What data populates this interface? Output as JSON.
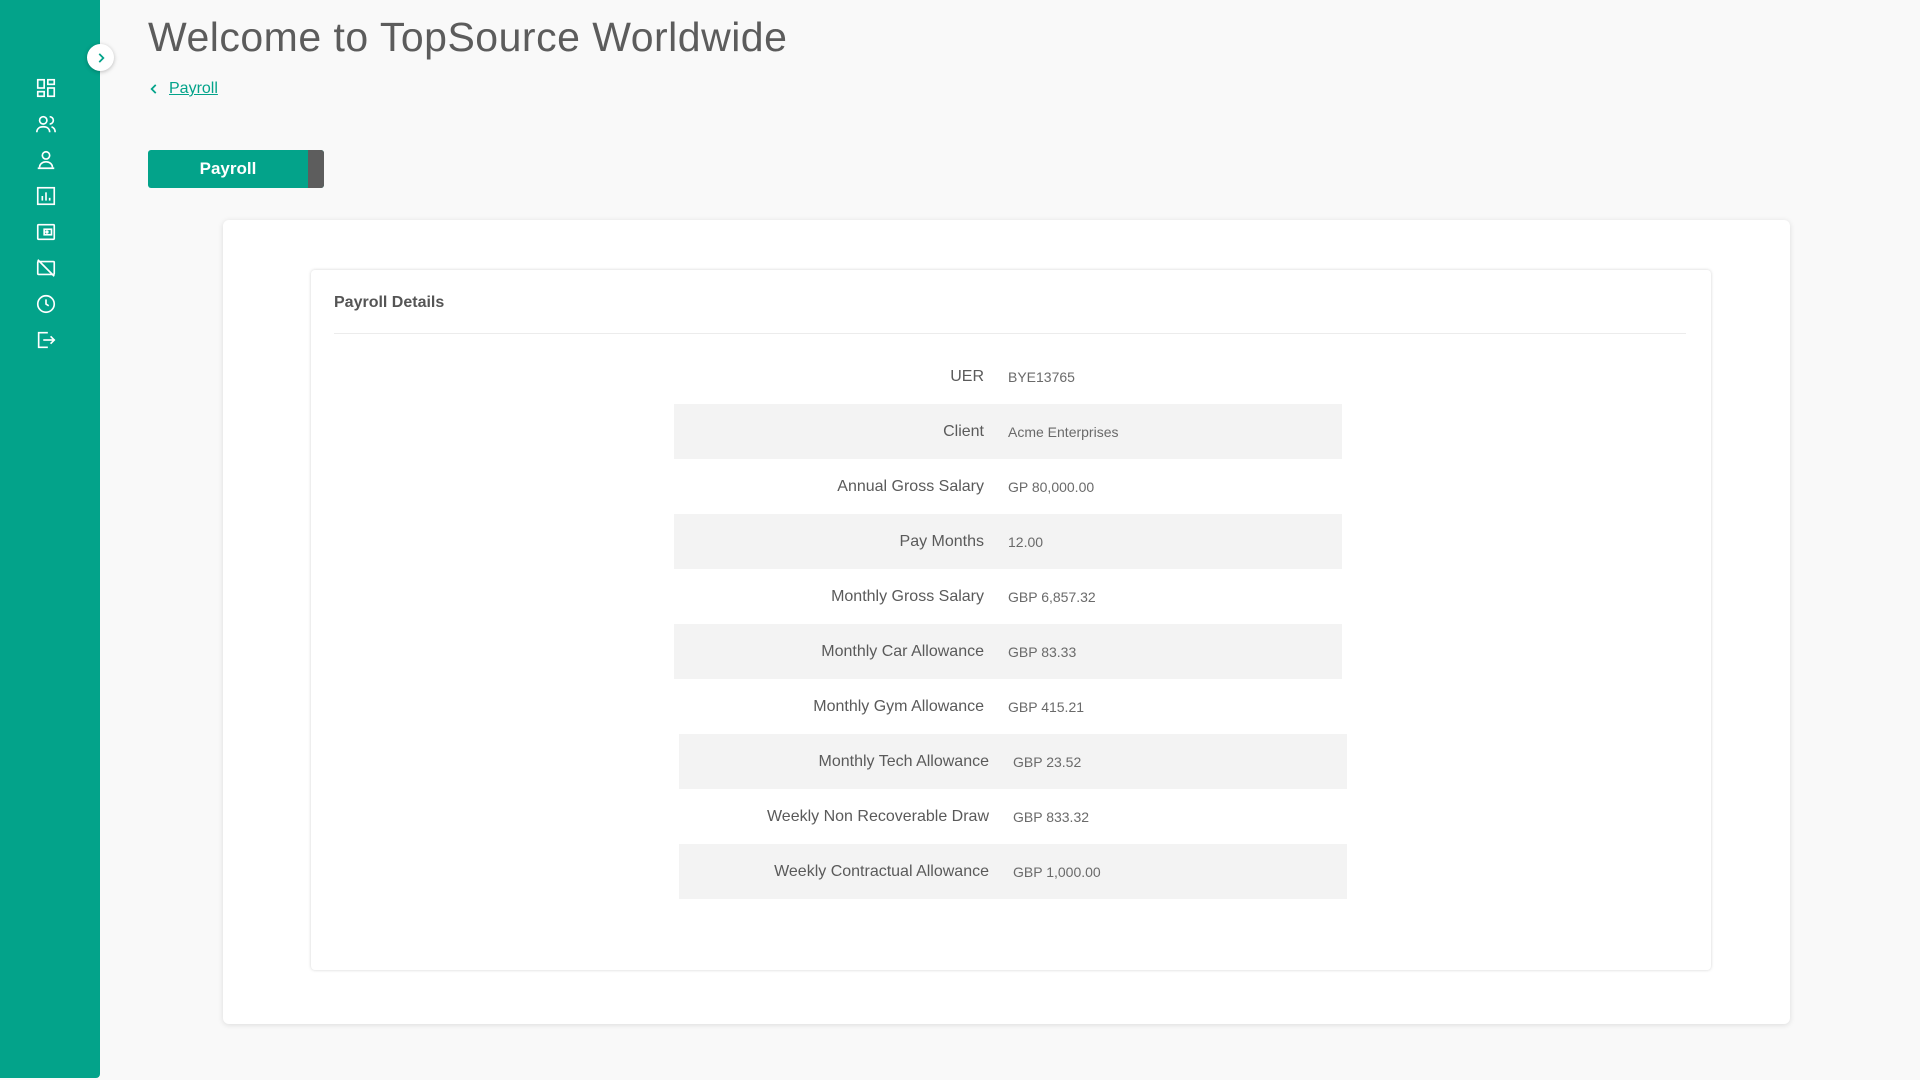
{
  "header": {
    "title": "Welcome to TopSource Worldwide"
  },
  "breadcrumb": {
    "back_label": "Payroll"
  },
  "tabs": {
    "active_label": "Payroll"
  },
  "sidebar": {
    "icons": [
      "dashboard-icon",
      "people-icon",
      "person-icon",
      "reports-icon",
      "wallet-icon",
      "no-camera-icon",
      "clock-icon",
      "logout-icon"
    ]
  },
  "card": {
    "title": "Payroll Details"
  },
  "details": [
    {
      "label": "UER",
      "value": "BYE13765"
    },
    {
      "label": "Client",
      "value": "Acme Enterprises"
    },
    {
      "label": "Annual Gross Salary",
      "value": "GP 80,000.00"
    },
    {
      "label": "Pay Months",
      "value": "12.00"
    },
    {
      "label": "Monthly Gross Salary",
      "value": "GBP 6,857.32"
    },
    {
      "label": "Monthly Car Allowance",
      "value": "GBP 83.33"
    },
    {
      "label": "Monthly Gym Allowance",
      "value": "GBP 415.21"
    },
    {
      "label": "Monthly Tech Allowance",
      "value": "GBP 23.52"
    },
    {
      "label": "Weekly Non Recoverable Draw",
      "value": "GBP 833.32"
    },
    {
      "label": "Weekly Contractual Allowance",
      "value": "GBP 1,000.00"
    }
  ],
  "colors": {
    "brand": "#03a38a",
    "row_shade": "#f3f3f3"
  }
}
